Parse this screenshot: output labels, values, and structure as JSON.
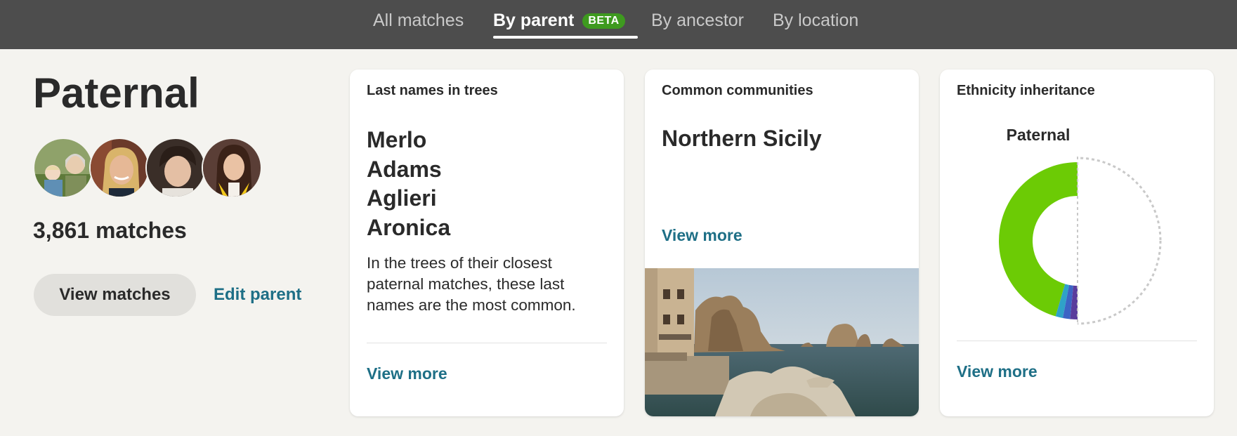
{
  "nav": {
    "tabs": [
      {
        "label": "All matches",
        "active": false
      },
      {
        "label": "By parent",
        "active": true,
        "badge": "BETA"
      },
      {
        "label": "By ancestor",
        "active": false
      },
      {
        "label": "By location",
        "active": false
      }
    ]
  },
  "parent": {
    "title": "Paternal",
    "match_count": "3,861 matches",
    "view_button": "View matches",
    "edit_link": "Edit parent",
    "avatars": [
      "avatar-1",
      "avatar-2",
      "avatar-3",
      "avatar-4"
    ]
  },
  "cards": {
    "names": {
      "title": "Last names in trees",
      "surnames": [
        "Merlo",
        "Adams",
        "Aglieri",
        "Aronica"
      ],
      "description": "In the trees of their closest paternal matches, these last names are the most common.",
      "view_more": "View more"
    },
    "communities": {
      "title": "Common communities",
      "community": "Northern Sicily",
      "view_more": "View more"
    },
    "ethnicity": {
      "title": "Ethnicity inheritance",
      "label": "Paternal",
      "view_more": "View more",
      "donut_segments": [
        {
          "color": "#6ccb05",
          "fraction": 0.455
        },
        {
          "color": "#2fa2c8",
          "fraction": 0.015
        },
        {
          "color": "#3c64c4",
          "fraction": 0.015
        },
        {
          "color": "#5a3c9c",
          "fraction": 0.015
        }
      ]
    }
  },
  "colors": {
    "nav_bg": "#4d4d4d",
    "page_bg": "#f4f3ef",
    "link": "#1e6f86",
    "beta_badge": "#3e9a1f",
    "donut_green": "#6ccb05"
  }
}
